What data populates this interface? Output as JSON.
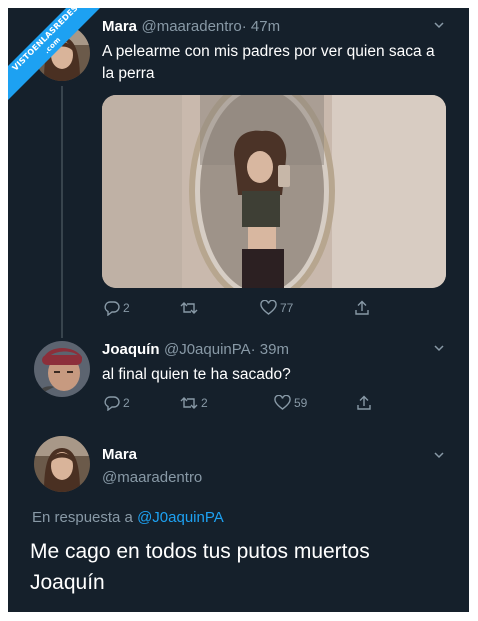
{
  "watermark": {
    "line1": "VISTOENLASREDES",
    "line2": ".com"
  },
  "tweet1": {
    "name": "Mara",
    "handle": "@maaradentro",
    "time": "· 47m",
    "text": "A pelearme con mis padres por ver quien saca a la perra",
    "replies": "2",
    "retweets": "",
    "likes": "77"
  },
  "tweet2": {
    "name": "Joaquín",
    "handle": "@J0aquinPA",
    "time": "· 39m",
    "text": "al final quien te ha sacado?",
    "replies": "2",
    "retweets": "2",
    "likes": "59"
  },
  "tweet3": {
    "name": "Mara",
    "handle": "@maaradentro",
    "reply_prefix": "En respuesta a",
    "reply_to": "@J0aquinPA",
    "text_line1": "Me cago en todos tus putos muertos",
    "text_line2": "Joaquín"
  },
  "colors": {
    "background": "#15202b",
    "secondary_text": "#8899a6",
    "link": "#1da1f2"
  }
}
